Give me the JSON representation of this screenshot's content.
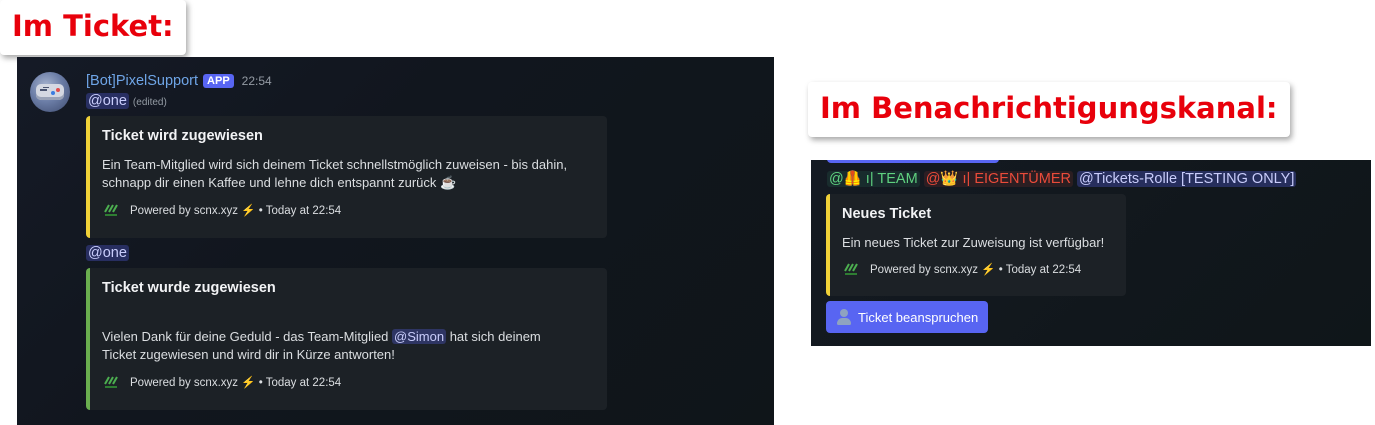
{
  "labels": {
    "in_ticket": "Im Ticket:",
    "in_channel": "Im Benachrichtigungskanal:"
  },
  "ticket": {
    "bot": {
      "name": "[Bot]PixelSupport",
      "badge": "APP",
      "time": "22:54"
    },
    "messages": [
      {
        "mention": "@one",
        "edited": "(edited)",
        "embed": {
          "accent": "#f0d138",
          "title": "Ticket wird zugewiesen",
          "desc_line1": "Ein Team-Mitglied wird sich deinem Ticket schnellstmöglich zuweisen - bis dahin,",
          "desc_line2": "schnapp dir einen Kaffee und lehne dich entspannt zurück ☕",
          "footer": "Powered by scnx.xyz ⚡ • Today at 22:54"
        }
      },
      {
        "mention": "@one",
        "embed": {
          "accent": "#6aae4f",
          "title": "Ticket wurde zugewiesen",
          "desc_prefix": "Vielen Dank für deine Geduld - das Team-Mitglied",
          "desc_mention": "@Simon",
          "desc_suffix": "hat sich deinem",
          "desc_line2": "Ticket zugewiesen und wird dir in Kürze antworten!",
          "footer": "Powered by scnx.xyz ⚡ • Today at 22:54"
        }
      }
    ]
  },
  "channel": {
    "roles": {
      "team": "@🦺 ı| TEAM",
      "owner": "@👑 ı| EIGENTÜMER",
      "tickets": "@Tickets-Rolle [TESTING ONLY]"
    },
    "embed": {
      "accent": "#f0d138",
      "title": "Neues Ticket",
      "desc": "Ein neues Ticket zur Zuweisung ist verfügbar!",
      "footer": "Powered by scnx.xyz ⚡ • Today at 22:54"
    },
    "button_label": "Ticket beanspruchen"
  },
  "colors": {
    "label_red": "#e8000b",
    "blurple": "#5865f2",
    "username": "#6fa5e7",
    "role_team": "#5fd17f",
    "role_owner": "#ea4b3a"
  },
  "icons": {
    "avatar": "gamepad-avatar",
    "footer": "scnx-logo-icon",
    "button": "person-icon"
  }
}
